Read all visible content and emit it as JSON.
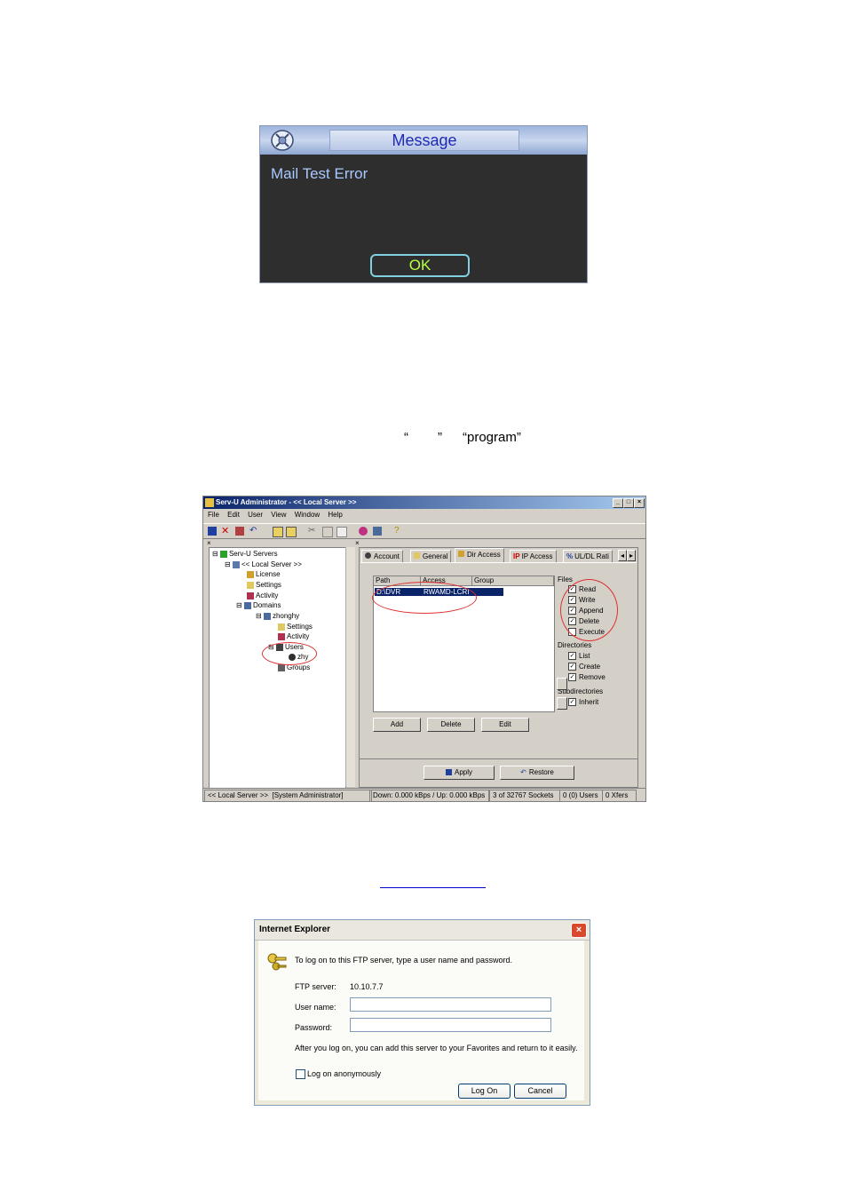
{
  "message_dialog": {
    "title": "Message",
    "text": "Mail Test Error",
    "ok_label": "OK",
    "colors": {
      "title_text": "#1d2bb8",
      "body_bg": "#2e2e2e",
      "text": "#a9c9ff",
      "ok_text": "#b8ff40"
    }
  },
  "instruction_text": {
    "open_quote": "“",
    "close_quote": "”",
    "program": "“program”"
  },
  "servu": {
    "title": "Serv-U Administrator - << Local Server >>",
    "menu": [
      "File",
      "Edit",
      "User",
      "View",
      "Window",
      "Help"
    ],
    "tree": {
      "root": "Serv-U Servers",
      "local_server": "<< Local Server >>",
      "license": "License",
      "settings": "Settings",
      "activity": "Activity",
      "domains": "Domains",
      "domain": "zhonghy",
      "domain_settings": "Settings",
      "domain_activity": "Activity",
      "users": "Users",
      "user": "zhy",
      "groups": "Groups"
    },
    "tabs": [
      "Account",
      "General",
      "Dir Access",
      "IP Access",
      "UL/DL Rati"
    ],
    "list_headers": [
      "Path",
      "Access",
      "Group"
    ],
    "row": {
      "path": "D:\\DVR",
      "access": "RWAMD-LCRI"
    },
    "files_label": "Files",
    "files": [
      {
        "label": "Read",
        "checked": true
      },
      {
        "label": "Write",
        "checked": true
      },
      {
        "label": "Append",
        "checked": true
      },
      {
        "label": "Delete",
        "checked": true
      },
      {
        "label": "Execute",
        "checked": false
      }
    ],
    "directories_label": "Directories",
    "directories": [
      {
        "label": "List",
        "checked": true
      },
      {
        "label": "Create",
        "checked": true
      },
      {
        "label": "Remove",
        "checked": true
      }
    ],
    "subdirectories_label": "Subdirectories",
    "subdirectories": [
      {
        "label": "Inherit",
        "checked": true
      }
    ],
    "buttons": {
      "add": "Add",
      "delete": "Delete",
      "edit": "Edit",
      "apply": "Apply",
      "restore": "Restore"
    },
    "status": [
      "<< Local Server >>",
      "[System Administrator]",
      "Down: 0.000 kBps / Up: 0.000 kBps",
      "3 of 32767 Sockets",
      "0 (0) Users",
      "0 Xfers"
    ]
  },
  "ie_dialog": {
    "title": "Internet Explorer",
    "intro": "To log on to this FTP server, type a user name and password.",
    "ftp_server_label": "FTP server:",
    "ftp_server_value": "10.10.7.7",
    "username_label": "User name:",
    "password_label": "Password:",
    "username_value": "",
    "password_value": "",
    "note": "After you log on, you can add this server to your Favorites and return to it easily.",
    "anonymous_label": "Log on anonymously",
    "logon_button": "Log On",
    "cancel_button": "Cancel"
  }
}
